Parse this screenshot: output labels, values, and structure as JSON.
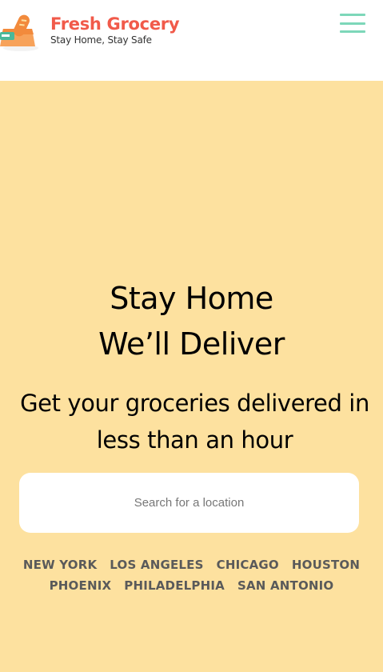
{
  "header": {
    "brand_name": "Fresh Grocery",
    "tagline": "Stay Home, Stay Safe",
    "logo_icon": "grocery-bag-icon",
    "menu_icon": "hamburger-menu-icon"
  },
  "hero": {
    "headline_line1": "Stay Home",
    "headline_line2": "We’ll Deliver",
    "subheadline": "Get your groceries delivered in less than an hour"
  },
  "search": {
    "placeholder": "Search for a location",
    "value": ""
  },
  "cities": {
    "row1": [
      "NEW YORK",
      "LOS ANGELES",
      "CHICAGO",
      "HOUSTON"
    ],
    "row2": [
      "PHOENIX",
      "PHILADELPHIA",
      "SAN ANTONIO"
    ]
  },
  "colors": {
    "brand": "#f15a4a",
    "menu": "#7dd7b9",
    "hero_background": "#fde19f",
    "city_text": "#5a5a5a"
  }
}
